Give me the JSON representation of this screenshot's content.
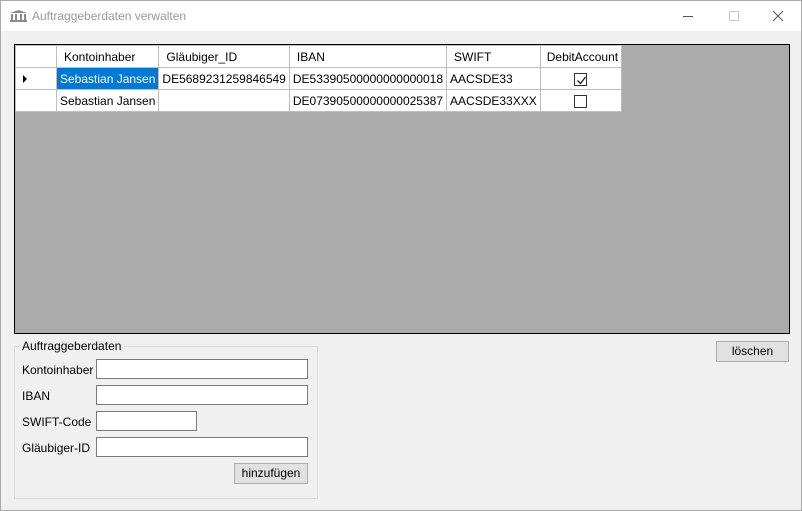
{
  "window": {
    "title": "Auftraggeberdaten verwalten",
    "icon": "bank-icon",
    "controls": [
      "minimize-icon",
      "maximize-icon",
      "close-icon"
    ]
  },
  "grid": {
    "columns": [
      "Kontoinhaber",
      "Gläubiger_ID",
      "IBAN",
      "SWIFT",
      "DebitAccount"
    ],
    "rows": [
      {
        "kontoinhaber": "Sebastian Jansen",
        "glaeubiger_id": "DE5689231259846549",
        "iban": "DE53390500000000000018",
        "swift": "AACSDE33",
        "debit_account": true
      },
      {
        "kontoinhaber": "Sebastian Jansen",
        "glaeubiger_id": "",
        "iban": "DE07390500000000025387",
        "swift": "AACSDE33XXX",
        "debit_account": false
      }
    ]
  },
  "buttons": {
    "loeschen": "löschen",
    "hinzufuegen": "hinzufügen"
  },
  "form": {
    "group_title": "Auftraggeberdaten",
    "kontoinhaber_label": "Kontoinhaber",
    "kontoinhaber_value": "",
    "iban_label": "IBAN",
    "iban_value": "",
    "swift_label": "SWIFT-Code",
    "swift_value": "",
    "glaeubiger_label": "Gläubiger-ID",
    "glaeubiger_value": ""
  },
  "colors": {
    "selection": "#0078d7",
    "grid_background": "#ababab",
    "window_background": "#f0f0f0"
  }
}
